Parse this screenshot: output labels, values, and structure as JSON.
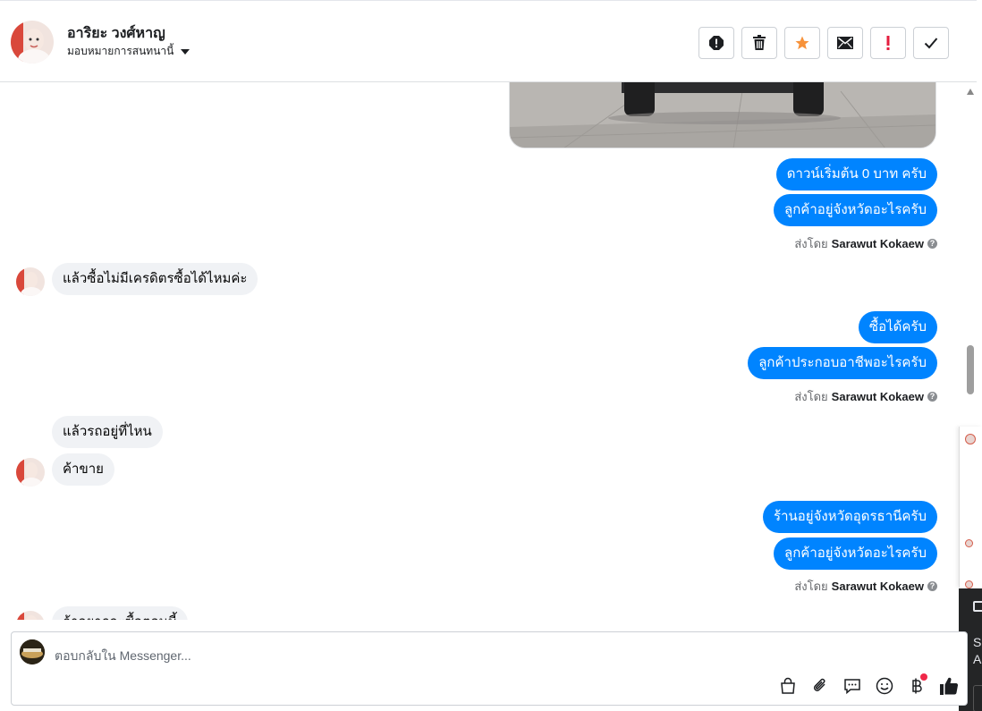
{
  "header": {
    "name": "อาริยะ วงศ์หาญ",
    "subtitle": "มอบหมายการสนทนานี้",
    "actions": [
      {
        "name": "report-icon",
        "label": "!"
      },
      {
        "name": "trash-icon",
        "label": ""
      },
      {
        "name": "star-icon",
        "label": ""
      },
      {
        "name": "envelope-icon",
        "label": ""
      },
      {
        "name": "important-icon",
        "label": "!"
      },
      {
        "name": "check-icon",
        "label": ""
      }
    ]
  },
  "conversation": {
    "messages": [
      {
        "dir": "out",
        "text": "ดาวน์เริ่มต้น 0 บาท ครับ"
      },
      {
        "dir": "out",
        "text": "ลูกค้าอยู่จังหวัดอะไรครับ"
      },
      {
        "dir": "sent_by",
        "prefix": "ส่งโดย",
        "sender": "Sarawut Kokaew"
      },
      {
        "dir": "in",
        "text": "แล้วซื้อไม่มีเครดิตรซื้อได้ไหมค่ะ"
      },
      {
        "dir": "out",
        "text": "ซื้อได้ครับ"
      },
      {
        "dir": "out",
        "text": "ลูกค้าประกอบอาชีพอะไรครับ"
      },
      {
        "dir": "sent_by",
        "prefix": "ส่งโดย",
        "sender": "Sarawut Kokaew"
      },
      {
        "dir": "in",
        "text": "แล้วรถอยู่ที่ไหน"
      },
      {
        "dir": "in",
        "text": "ค้าขาย"
      },
      {
        "dir": "out",
        "text": "ร้านอยู่จังหวัดอุดรธานีครับ"
      },
      {
        "dir": "out",
        "text": "ลูกค้าอยู่จังหวัดอะไรครับ"
      },
      {
        "dir": "sent_by",
        "prefix": "ส่งโดย",
        "sender": "Sarawut Kokaew"
      },
      {
        "dir": "in",
        "text": "ถ้าอยากจะซื้อตอนนี้"
      }
    ]
  },
  "side_panel": {
    "line1": "Se",
    "line2": "A"
  },
  "composer": {
    "placeholder": "ตอบกลับใน Messenger...",
    "tools": [
      "bag-icon",
      "paperclip-icon",
      "speech-bubble-icon",
      "emoji-icon",
      "baht-icon",
      "thumbs-up-icon"
    ]
  },
  "colors": {
    "outgoing": "#0084ff",
    "incoming": "#f0f2f5",
    "star": "#f7923a",
    "important": "#e41e3f"
  }
}
